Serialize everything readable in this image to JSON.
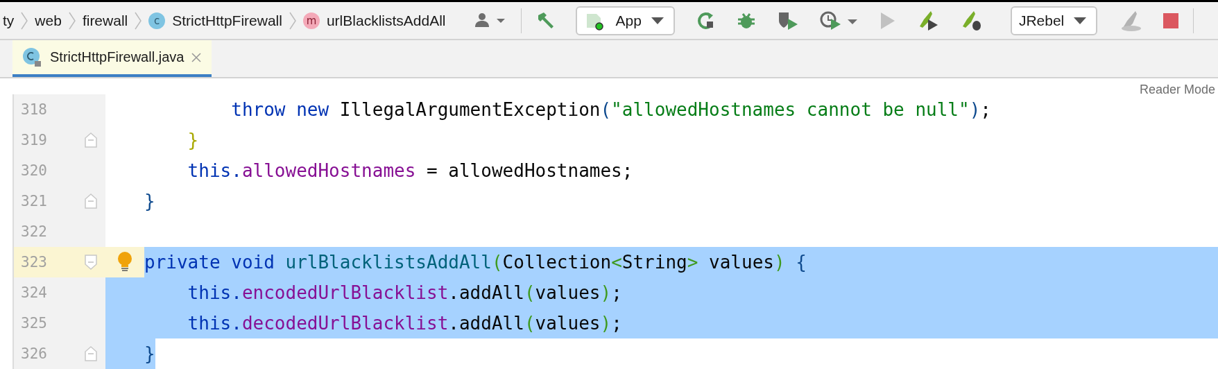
{
  "breadcrumbs": [
    {
      "label": "ty",
      "kind": "package"
    },
    {
      "label": "web",
      "kind": "package"
    },
    {
      "label": "firewall",
      "kind": "package"
    },
    {
      "label": "StrictHttpFirewall",
      "kind": "class",
      "badge": "c"
    },
    {
      "label": "urlBlacklistsAddAll",
      "kind": "method",
      "badge": "m"
    }
  ],
  "toolbar": [
    {
      "kind": "user",
      "disabled": false
    },
    {
      "kind": "build",
      "disabled": false
    },
    {
      "kind": "config",
      "label": "App",
      "disabled": false
    },
    {
      "kind": "rerun",
      "disabled": false
    },
    {
      "kind": "debug",
      "disabled": false
    },
    {
      "kind": "coverage",
      "disabled": false
    },
    {
      "kind": "profile",
      "disabled": false
    },
    {
      "kind": "run",
      "disabled": true
    },
    {
      "kind": "jrebel-run",
      "disabled": false
    },
    {
      "kind": "jrebel-debug",
      "disabled": false
    },
    {
      "kind": "config",
      "label": "JRebel",
      "disabled": false
    },
    {
      "kind": "rocket",
      "disabled": true
    },
    {
      "kind": "stop",
      "disabled": false
    }
  ],
  "tabs": [
    {
      "label": "StrictHttpFirewall.java",
      "selected": true
    }
  ],
  "editor": {
    "reader_mode": "Reader Mode",
    "lines": [
      {
        "number": "318",
        "current": false,
        "selected": false,
        "tokens": [
          {
            "text": "        throw new",
            "kind": "kw"
          },
          {
            "text": " IllegalArgumentException",
            "kind": "plain"
          },
          {
            "text": "(",
            "kind": "brace1"
          },
          {
            "text": "\"allowedHostnames cannot be null\"",
            "kind": "string"
          },
          {
            "text": ")",
            "kind": "brace1"
          },
          {
            "text": ";",
            "kind": "plain"
          }
        ]
      },
      {
        "number": "319",
        "fold_close": true,
        "current": false,
        "selected": false,
        "tokens": [
          {
            "text": "    }",
            "kind": "brace2"
          }
        ]
      },
      {
        "number": "320",
        "current": false,
        "selected": false,
        "tokens": [
          {
            "text": "    this.",
            "kind": "kw"
          },
          {
            "text": "allowedHostnames",
            "kind": "field"
          },
          {
            "text": " = allowedHostnames;",
            "kind": "plain"
          }
        ]
      },
      {
        "number": "321",
        "fold_close": true,
        "current": false,
        "selected": false,
        "tokens": [
          {
            "text": "}",
            "kind": "brace1"
          }
        ]
      },
      {
        "number": "322",
        "current": false,
        "selected": false
      },
      {
        "number": "323",
        "fold_open": true,
        "bulb": true,
        "current": true,
        "selected": true,
        "tokens": [
          {
            "text": "private void",
            "kind": "kw"
          },
          {
            "text": " urlBlacklistsAddAll",
            "kind": "method"
          },
          {
            "text": "(",
            "kind": "brace3"
          },
          {
            "text": "Collection",
            "kind": "plain"
          },
          {
            "text": "<",
            "kind": "brace3"
          },
          {
            "text": "String",
            "kind": "plain"
          },
          {
            "text": ">",
            "kind": "brace3"
          },
          {
            "text": " values",
            "kind": "plain"
          },
          {
            "text": ")",
            "kind": "brace3"
          },
          {
            "text": " {",
            "kind": "brace1"
          }
        ]
      },
      {
        "number": "324",
        "current": false,
        "selected": true,
        "tokens": [
          {
            "text": "    this.",
            "kind": "kw"
          },
          {
            "text": "encodedUrlBlacklist",
            "kind": "field"
          },
          {
            "text": ".addAll",
            "kind": "plain"
          },
          {
            "text": "(",
            "kind": "brace3"
          },
          {
            "text": "values",
            "kind": "plain"
          },
          {
            "text": ")",
            "kind": "brace3"
          },
          {
            "text": ";",
            "kind": "plain"
          }
        ]
      },
      {
        "number": "325",
        "current": false,
        "selected": true,
        "tokens": [
          {
            "text": "    this.",
            "kind": "kw"
          },
          {
            "text": "decodedUrlBlacklist",
            "kind": "field"
          },
          {
            "text": ".addAll",
            "kind": "plain"
          },
          {
            "text": "(",
            "kind": "brace3"
          },
          {
            "text": "values",
            "kind": "plain"
          },
          {
            "text": ")",
            "kind": "brace3"
          },
          {
            "text": ";",
            "kind": "plain"
          }
        ]
      },
      {
        "number": "326",
        "fold_close": true,
        "current": false,
        "selected": true,
        "tokens": [
          {
            "text": "}",
            "kind": "brace1"
          }
        ]
      }
    ]
  }
}
